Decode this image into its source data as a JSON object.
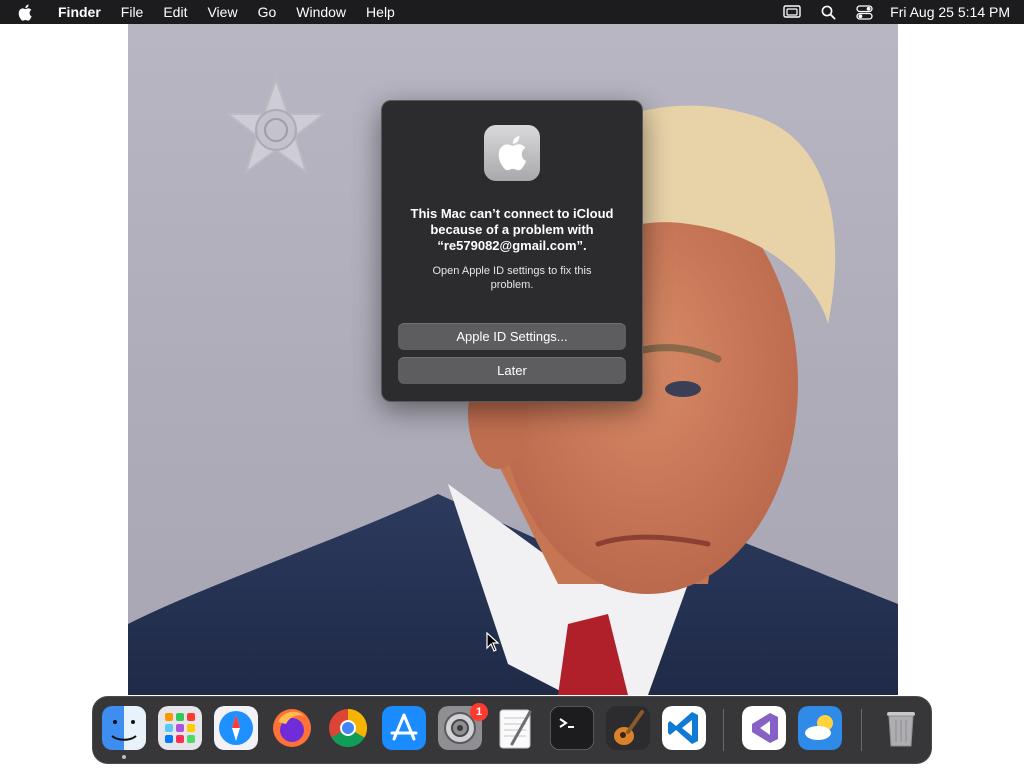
{
  "menubar": {
    "app_name": "Finder",
    "menus": [
      "File",
      "Edit",
      "View",
      "Go",
      "Window",
      "Help"
    ],
    "clock": "Fri Aug 25  5:14 PM"
  },
  "dialog": {
    "title": "This Mac can’t connect to iCloud because of a problem with “re579082@gmail.com”.",
    "message": "Open Apple ID settings to fix this problem.",
    "primary_button": "Apple ID Settings...",
    "secondary_button": "Later"
  },
  "dock": {
    "apps": [
      {
        "name": "Finder",
        "icon": "finder-icon",
        "running": true
      },
      {
        "name": "Launchpad",
        "icon": "launchpad-icon"
      },
      {
        "name": "Safari",
        "icon": "safari-icon"
      },
      {
        "name": "Firefox",
        "icon": "firefox-icon"
      },
      {
        "name": "Chrome",
        "icon": "chrome-icon"
      },
      {
        "name": "App Store",
        "icon": "app-store-icon"
      },
      {
        "name": "System Settings",
        "icon": "system-settings-icon",
        "badge": "1"
      },
      {
        "name": "TextEdit",
        "icon": "textedit-icon"
      },
      {
        "name": "Terminal",
        "icon": "terminal-icon"
      },
      {
        "name": "GarageBand",
        "icon": "garageband-icon"
      },
      {
        "name": "Visual Studio Code",
        "icon": "vscode-icon"
      },
      {
        "name": "Visual Studio",
        "icon": "visual-studio-icon"
      },
      {
        "name": "Weather",
        "icon": "weather-icon"
      },
      {
        "name": "Trash",
        "icon": "trash-icon"
      }
    ]
  },
  "colors": {
    "menubar_bg": "#1c1c1e",
    "dialog_bg": "#2c2c2e",
    "button_bg": "#5d5d60",
    "badge_red": "#ff3b30"
  }
}
